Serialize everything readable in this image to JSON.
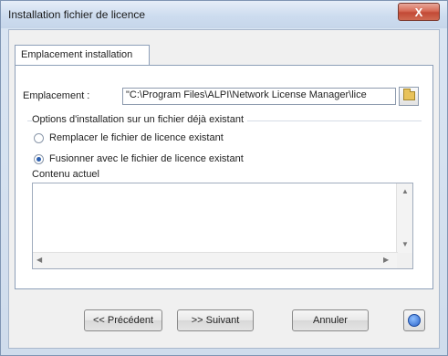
{
  "window": {
    "title": "Installation fichier de licence",
    "close_label": "X"
  },
  "tabs": [
    {
      "label": "Emplacement installation",
      "selected": true
    }
  ],
  "location": {
    "label": "Emplacement :",
    "value": "\"C:\\Program Files\\ALPI\\Network License Manager\\lice"
  },
  "options": {
    "group_label": "Options d'installation sur un fichier déjà existant",
    "radios": [
      {
        "label": "Remplacer le fichier de licence existant",
        "checked": false
      },
      {
        "label": "Fusionner avec le fichier de licence existant",
        "checked": true
      }
    ]
  },
  "content": {
    "label": "Contenu actuel",
    "value": ""
  },
  "buttons": {
    "previous": "<< Précédent",
    "next": ">> Suivant",
    "cancel": "Annuler"
  },
  "icons": {
    "browse": "folder-icon",
    "help": "help-icon"
  }
}
